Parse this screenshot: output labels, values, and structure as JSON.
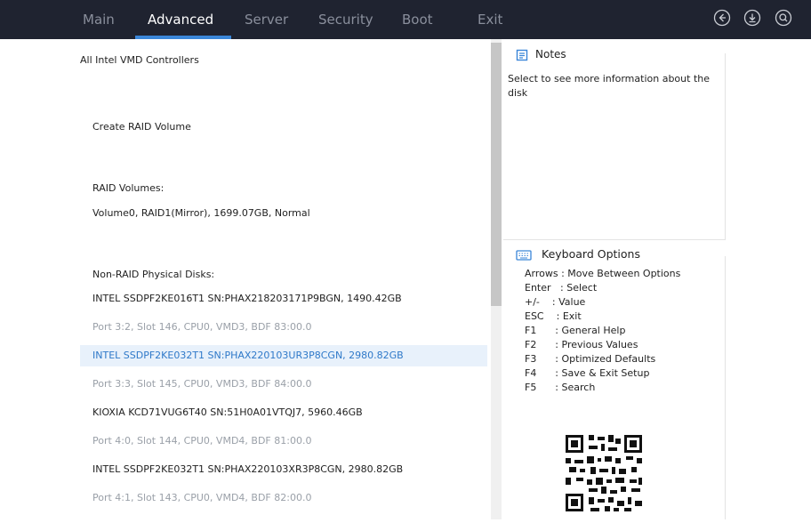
{
  "tabs": [
    "Main",
    "Advanced",
    "Server",
    "Security",
    "Boot",
    "Exit"
  ],
  "top_icons": [
    "back-icon",
    "download-icon",
    "search-icon"
  ],
  "left": {
    "heading": "All Intel VMD Controllers",
    "create_raid": "Create RAID Volume",
    "raid_volumes_label": "RAID Volumes:",
    "volume0": "Volume0, RAID1(Mirror), 1699.07GB, Normal",
    "non_raid_label": "Non-RAID Physical Disks:",
    "disks": [
      {
        "name": "INTEL SSDPF2KE016T1 SN:PHAX218203171P9BGN, 1490.42GB",
        "port": "Port 3:2, Slot 146, CPU0, VMD3, BDF 83:00.0"
      },
      {
        "name": "INTEL SSDPF2KE032T1 SN:PHAX220103UR3P8CGN, 2980.82GB",
        "port": "Port 3:3, Slot 145, CPU0, VMD3, BDF 84:00.0"
      },
      {
        "name": "KIOXIA KCD71VUG6T40 SN:51H0A01VTQJ7, 5960.46GB",
        "port": "Port 4:0, Slot 144, CPU0, VMD4, BDF 81:00.0"
      },
      {
        "name": "INTEL SSDPF2KE032T1 SN:PHAX220103XR3P8CGN, 2980.82GB",
        "port": "Port 4:1, Slot 143, CPU0, VMD4, BDF 82:00.0"
      }
    ]
  },
  "notes": {
    "title": "Notes",
    "text": "Select to see more information about the disk"
  },
  "keyboard": {
    "title": "Keyboard Options",
    "options": [
      {
        "key": "Arrows",
        "desc": " : Move Between Options"
      },
      {
        "key": "Enter",
        "desc": "   : Select"
      },
      {
        "key": "+/-",
        "desc": "    : Value"
      },
      {
        "key": "ESC",
        "desc": "    : Exit"
      },
      {
        "key": "F1",
        "desc": "      : General Help"
      },
      {
        "key": "F2",
        "desc": "      : Previous Values"
      },
      {
        "key": "F3",
        "desc": "      : Optimized Defaults"
      },
      {
        "key": "F4",
        "desc": "      : Save & Exit Setup"
      },
      {
        "key": "F5",
        "desc": "      : Search"
      }
    ]
  },
  "colors": {
    "topbar": "#1f2330",
    "accent": "#3a86d8",
    "selected_bg": "#e8f1fb",
    "selected_text": "#2f79c9",
    "muted": "#9aa0a8"
  }
}
